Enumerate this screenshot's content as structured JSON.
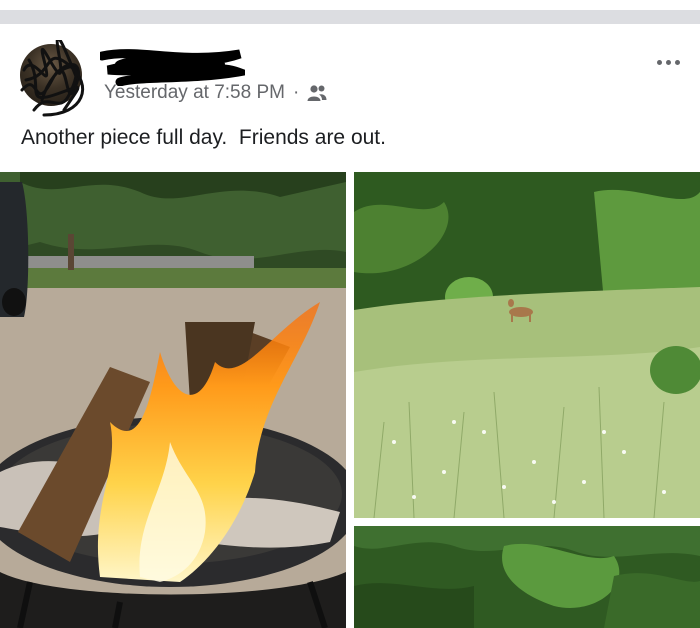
{
  "post": {
    "timestamp": "Yesterday at 7:58 PM",
    "separator": "·",
    "audience_icon": "friends-icon",
    "text": "Another piece full day.  Friends are out.",
    "more_icon": "more-options-icon"
  },
  "photos": [
    {
      "subject": "campfire-photo"
    },
    {
      "subject": "deer-meadow-photo"
    },
    {
      "subject": "tree-line-photo"
    }
  ],
  "colors": {
    "meta_text": "#65676b",
    "body_text": "#1c1e21",
    "divider": "#dcdde1"
  }
}
